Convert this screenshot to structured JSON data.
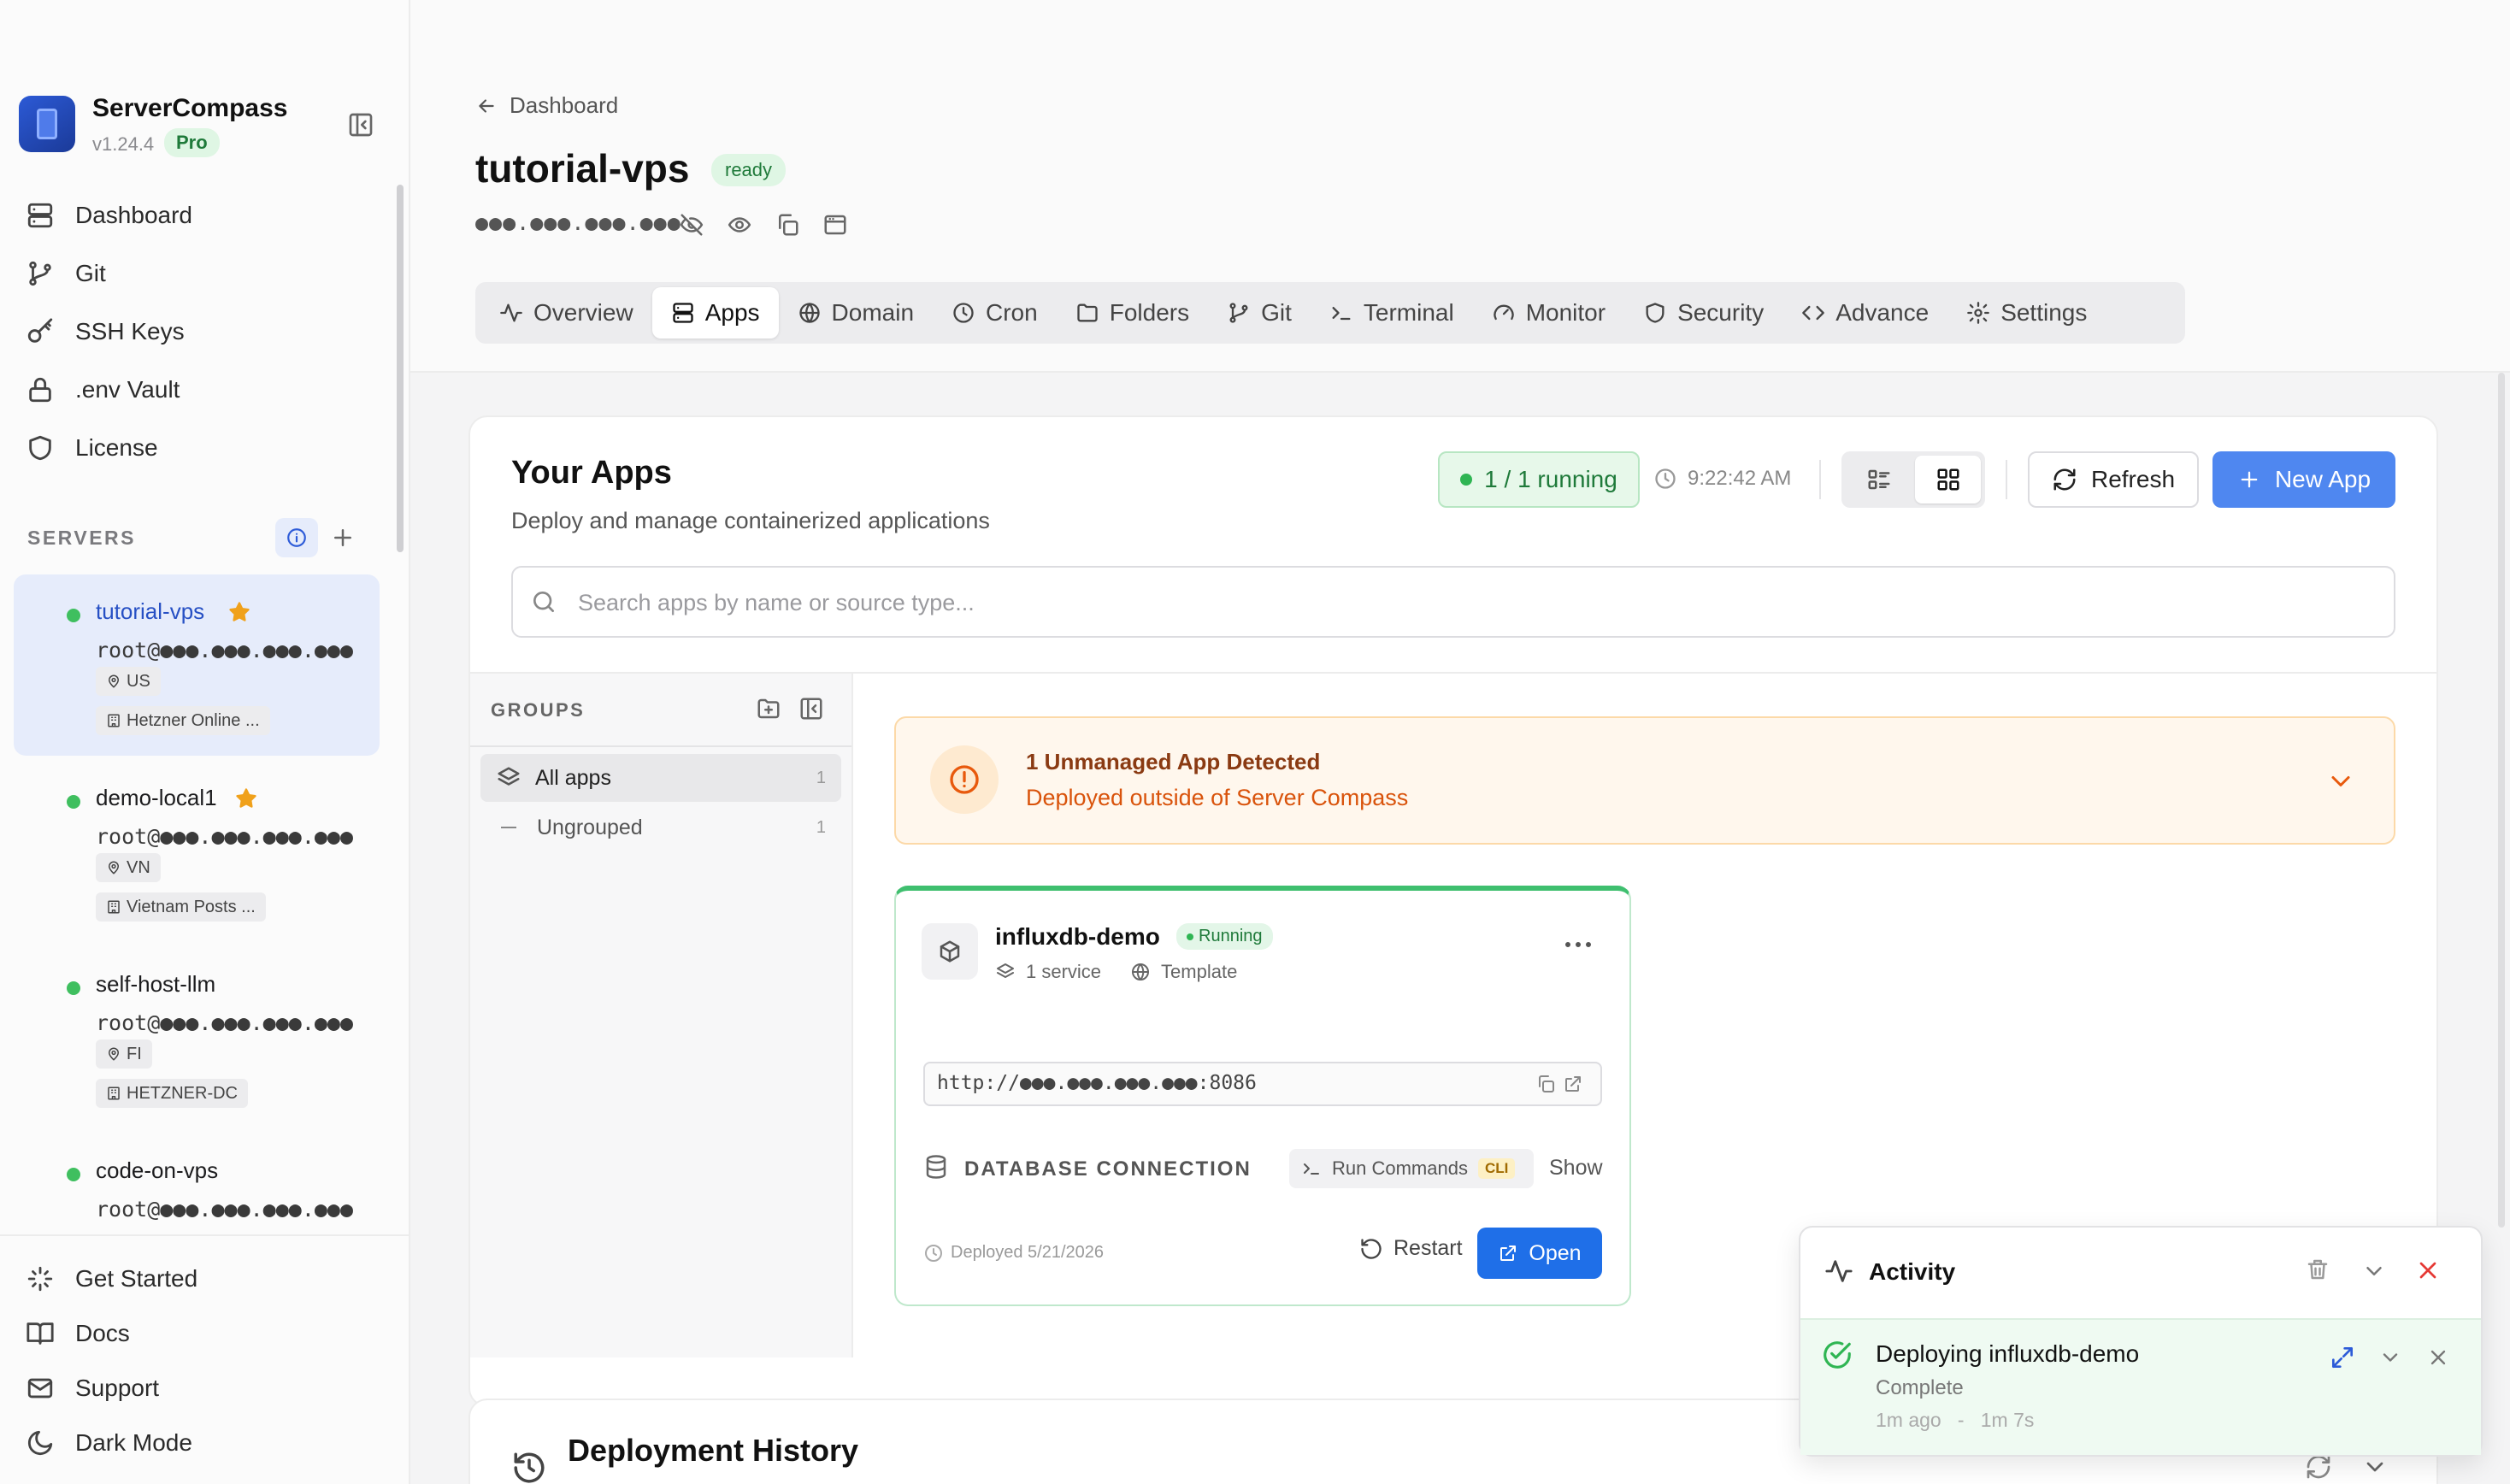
{
  "app": {
    "name": "ServerCompass",
    "version": "v1.24.4",
    "plan": "Pro"
  },
  "sidebar": {
    "nav": [
      {
        "label": "Dashboard",
        "icon": "server-icon"
      },
      {
        "label": "Git",
        "icon": "git-branch-icon"
      },
      {
        "label": "SSH Keys",
        "icon": "key-icon"
      },
      {
        "label": ".env Vault",
        "icon": "lock-icon"
      },
      {
        "label": "License",
        "icon": "shield-icon"
      }
    ],
    "servers_heading": "SERVERS",
    "servers": [
      {
        "name": "tutorial-vps",
        "starred": true,
        "user": "root@●●●.●●●.●●●.●●●",
        "region": "US",
        "provider": "Hetzner Online ...",
        "status": "online",
        "active": true
      },
      {
        "name": "demo-local1",
        "starred": true,
        "user": "root@●●●.●●●.●●●.●●●",
        "region": "VN",
        "provider": "Vietnam Posts ...",
        "status": "online",
        "active": false
      },
      {
        "name": "self-host-llm",
        "starred": false,
        "user": "root@●●●.●●●.●●●.●●●",
        "region": "FI",
        "provider": "HETZNER-DC",
        "status": "online",
        "active": false
      },
      {
        "name": "code-on-vps",
        "starred": false,
        "user": "root@●●●.●●●.●●●.●●●",
        "region": "",
        "provider": "",
        "status": "online",
        "active": false
      }
    ],
    "footer": [
      {
        "label": "Get Started",
        "icon": "sparkles-icon"
      },
      {
        "label": "Docs",
        "icon": "book-icon"
      },
      {
        "label": "Support",
        "icon": "mail-icon"
      },
      {
        "label": "Dark Mode",
        "icon": "moon-icon"
      }
    ]
  },
  "header": {
    "breadcrumb": "Dashboard",
    "server_name": "tutorial-vps",
    "status_badge": "ready",
    "ip_masked": "●●●.●●●.●●●.●●●",
    "tabs": [
      {
        "label": "Overview",
        "icon": "activity-icon",
        "active": false
      },
      {
        "label": "Apps",
        "icon": "server-icon",
        "active": true
      },
      {
        "label": "Domain",
        "icon": "globe-icon",
        "active": false
      },
      {
        "label": "Cron",
        "icon": "clock-icon",
        "active": false
      },
      {
        "label": "Folders",
        "icon": "folder-icon",
        "active": false
      },
      {
        "label": "Git",
        "icon": "git-branch-icon",
        "active": false
      },
      {
        "label": "Terminal",
        "icon": "terminal-icon",
        "active": false
      },
      {
        "label": "Monitor",
        "icon": "gauge-icon",
        "active": false
      },
      {
        "label": "Security",
        "icon": "shield-icon",
        "active": false
      },
      {
        "label": "Advance",
        "icon": "code-icon",
        "active": false
      },
      {
        "label": "Settings",
        "icon": "gear-icon",
        "active": false
      }
    ]
  },
  "apps": {
    "title": "Your Apps",
    "subtitle": "Deploy and manage containerized applications",
    "running_status": "1 / 1 running",
    "last_updated": "9:22:42 AM",
    "view_mode": "grid",
    "refresh_label": "Refresh",
    "new_app_label": "New App",
    "search_placeholder": "Search apps by name or source type...",
    "search_value": ""
  },
  "groups": {
    "heading": "GROUPS",
    "items": [
      {
        "label": "All apps",
        "count": "1",
        "active": true
      },
      {
        "label": "Ungrouped",
        "count": "1",
        "active": false
      }
    ]
  },
  "unmanaged": {
    "title": "1 Unmanaged App Detected",
    "subtitle": "Deployed outside of Server Compass"
  },
  "app_card": {
    "name": "influxdb-demo",
    "status": "Running",
    "services": "1 service",
    "source": "Template",
    "url": "http://●●●.●●●.●●●.●●●:8086",
    "db_label": "DATABASE CONNECTION",
    "run_commands": "Run Commands",
    "cli_badge": "CLI",
    "show_label": "Show",
    "deployed": "Deployed 5/21/2026",
    "restart_label": "Restart",
    "open_label": "Open"
  },
  "deployment_history": {
    "title": "Deployment History"
  },
  "activity": {
    "title": "Activity",
    "item": {
      "title": "Deploying influxdb-demo",
      "status": "Complete",
      "time": "1m ago",
      "separator": "-",
      "duration": "1m 7s"
    }
  },
  "colors": {
    "accent": "#4f87f0",
    "primary_button": "#1f6fe8",
    "success": "#2fb553",
    "warning": "#e8590c",
    "danger": "#e53935"
  }
}
